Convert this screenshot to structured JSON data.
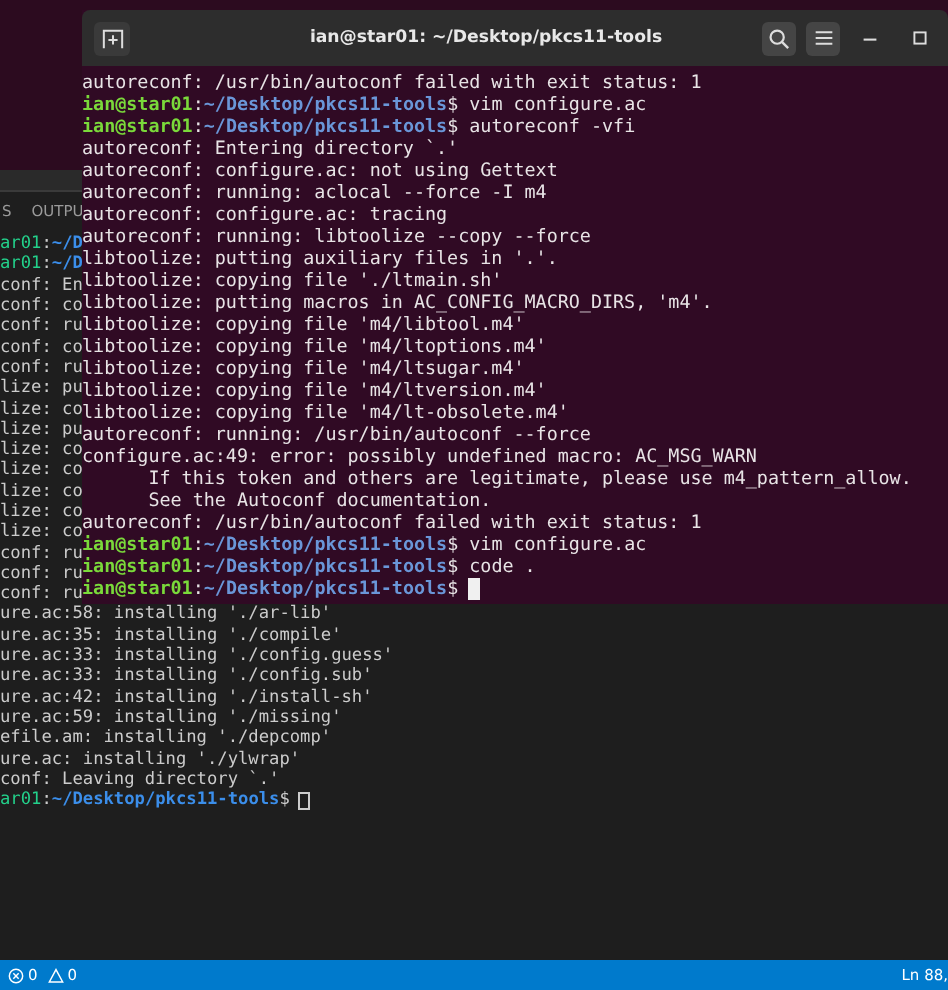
{
  "terminal_window": {
    "title": "ian@star01: ~/Desktop/pkcs11-tools",
    "lines": [
      {
        "kind": "text",
        "text": "autoreconf: /usr/bin/autoconf failed with exit status: 1"
      },
      {
        "kind": "prompt",
        "user": "ian@star01",
        "colon": ":",
        "path": "~/Desktop/pkcs11-tools",
        "sign": "$",
        "command": "vim configure.ac"
      },
      {
        "kind": "prompt",
        "user": "ian@star01",
        "colon": ":",
        "path": "~/Desktop/pkcs11-tools",
        "sign": "$",
        "command": "autoreconf -vfi"
      },
      {
        "kind": "text",
        "text": "autoreconf: Entering directory `.'"
      },
      {
        "kind": "text",
        "text": "autoreconf: configure.ac: not using Gettext"
      },
      {
        "kind": "text",
        "text": "autoreconf: running: aclocal --force -I m4"
      },
      {
        "kind": "text",
        "text": "autoreconf: configure.ac: tracing"
      },
      {
        "kind": "text",
        "text": "autoreconf: running: libtoolize --copy --force"
      },
      {
        "kind": "text",
        "text": "libtoolize: putting auxiliary files in '.'."
      },
      {
        "kind": "text",
        "text": "libtoolize: copying file './ltmain.sh'"
      },
      {
        "kind": "text",
        "text": "libtoolize: putting macros in AC_CONFIG_MACRO_DIRS, 'm4'."
      },
      {
        "kind": "text",
        "text": "libtoolize: copying file 'm4/libtool.m4'"
      },
      {
        "kind": "text",
        "text": "libtoolize: copying file 'm4/ltoptions.m4'"
      },
      {
        "kind": "text",
        "text": "libtoolize: copying file 'm4/ltsugar.m4'"
      },
      {
        "kind": "text",
        "text": "libtoolize: copying file 'm4/ltversion.m4'"
      },
      {
        "kind": "text",
        "text": "libtoolize: copying file 'm4/lt-obsolete.m4'"
      },
      {
        "kind": "text",
        "text": "autoreconf: running: /usr/bin/autoconf --force"
      },
      {
        "kind": "text",
        "text": "configure.ac:49: error: possibly undefined macro: AC_MSG_WARN"
      },
      {
        "kind": "text",
        "text": "      If this token and others are legitimate, please use m4_pattern_allow."
      },
      {
        "kind": "text",
        "text": "      See the Autoconf documentation."
      },
      {
        "kind": "text",
        "text": "autoreconf: /usr/bin/autoconf failed with exit status: 1"
      },
      {
        "kind": "prompt",
        "user": "ian@star01",
        "colon": ":",
        "path": "~/Desktop/pkcs11-tools",
        "sign": "$",
        "command": "vim configure.ac"
      },
      {
        "kind": "prompt",
        "user": "ian@star01",
        "colon": ":",
        "path": "~/Desktop/pkcs11-tools",
        "sign": "$",
        "command": "code ."
      },
      {
        "kind": "prompt",
        "user": "ian@star01",
        "colon": ":",
        "path": "~/Desktop/pkcs11-tools",
        "sign": "$",
        "cursor": true
      }
    ]
  },
  "vscode_panel": {
    "tabs": [
      {
        "label": "S",
        "selected": false
      },
      {
        "label": "OUTPU",
        "selected": false
      }
    ],
    "lines": [
      {
        "kind": "prompt",
        "user": "ar01",
        "colon": ":",
        "path": "~/D"
      },
      {
        "kind": "prompt",
        "user": "ar01",
        "colon": ":",
        "path": "~/D"
      },
      {
        "kind": "text",
        "text": "conf: En"
      },
      {
        "kind": "text",
        "text": "conf: co"
      },
      {
        "kind": "text",
        "text": "conf: ru"
      },
      {
        "kind": "text",
        "text": "conf: co"
      },
      {
        "kind": "text",
        "text": "conf: ru"
      },
      {
        "kind": "text",
        "text": "lize: pu"
      },
      {
        "kind": "text",
        "text": "lize: co"
      },
      {
        "kind": "text",
        "text": "lize: pu"
      },
      {
        "kind": "text",
        "text": "lize: co"
      },
      {
        "kind": "text",
        "text": "lize: co"
      },
      {
        "kind": "text",
        "text": "lize: co"
      },
      {
        "kind": "text",
        "text": "lize: co"
      },
      {
        "kind": "text",
        "text": "lize: co"
      },
      {
        "kind": "text",
        "text": "conf: ru"
      },
      {
        "kind": "text",
        "text": "conf: ru"
      },
      {
        "kind": "text",
        "text": "conf: ru"
      },
      {
        "kind": "text",
        "text": "ure.ac:58: installing './ar-lib'"
      },
      {
        "kind": "text",
        "text": "ure.ac:35: installing './compile'"
      },
      {
        "kind": "text",
        "text": "ure.ac:33: installing './config.guess'"
      },
      {
        "kind": "text",
        "text": "ure.ac:33: installing './config.sub'"
      },
      {
        "kind": "text",
        "text": "ure.ac:42: installing './install-sh'"
      },
      {
        "kind": "text",
        "text": "ure.ac:59: installing './missing'"
      },
      {
        "kind": "text",
        "text": "efile.am: installing './depcomp'"
      },
      {
        "kind": "text",
        "text": "ure.ac: installing './ylwrap'"
      },
      {
        "kind": "text",
        "text": "conf: Leaving directory `.'"
      },
      {
        "kind": "prompt",
        "user": "ar01",
        "colon": ":",
        "path": "~/Desktop/pkcs11-tools",
        "sign": "$",
        "cursor": true
      }
    ]
  },
  "status_bar": {
    "errors": "0",
    "warnings": "0",
    "position": "Ln 88,"
  }
}
